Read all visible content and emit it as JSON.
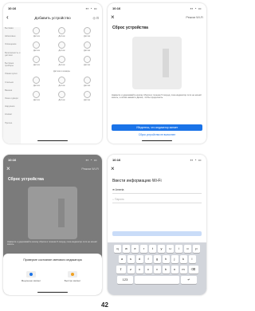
{
  "status_bar": {
    "time": "10:16",
    "time_2": "10:16 ▾",
    "signal": "▪▪ ◔ ▭"
  },
  "screen1": {
    "title": "Добавить устройство",
    "sidebar": [
      "Бытовая",
      "Шлюзовые",
      "Освещение",
      "Безопасность и датчики",
      "Бытовые приборы",
      "Умная кухня",
      "Спальня",
      "Ванная",
      "Окна и двери",
      "Наружное",
      "Климат",
      "Прочее"
    ],
    "grid": [
      [
        "Датчик",
        "Датчик",
        "Датчик"
      ],
      [
        "Датчик",
        "Датчик",
        "Датчик"
      ],
      [
        "Датчик",
        "Датчик",
        "Датчик"
      ],
      [
        "Датчик",
        "Датчик",
        "Датчик"
      ],
      [
        "Датчик",
        "Датчик",
        "Датчик"
      ]
    ],
    "section_label": "Датчики и камеры"
  },
  "screen2": {
    "action": "Режим Wi-Fi",
    "title": "Сброс устройства",
    "text": "Нажмите и удерживайте кнопку сброса в течение 5 секунд, пока индикатор сети не начнёт мигать, а затем нажмите Далее, чтобы продолжить.",
    "primary": "Убедитесь, что индикатор мигает",
    "secondary": "Сброс устройства не выполнен"
  },
  "screen3": {
    "action": "Режим Wi-Fi",
    "title": "Сброс устройства",
    "text": "Нажмите и удерживайте кнопку сброса в течение 5 секунд, пока индикатор сети не начнёт мигать.",
    "sheet_title": "Проверьте состояние светового индикатора",
    "opt1": "Медленно мигает",
    "opt2": "Быстро мигает"
  },
  "screen4": {
    "title": "Ввести информацию Wi-Fi",
    "ssid": "Ameria",
    "password_placeholder": "Пароль",
    "keys_row1": [
      "q",
      "w",
      "e",
      "r",
      "t",
      "y",
      "u",
      "i",
      "o",
      "p"
    ],
    "keys_row2": [
      "a",
      "s",
      "d",
      "f",
      "g",
      "h",
      "j",
      "k",
      "l"
    ],
    "keys_row3": [
      "z",
      "x",
      "c",
      "v",
      "b",
      "n",
      "m"
    ]
  },
  "caption": "42"
}
